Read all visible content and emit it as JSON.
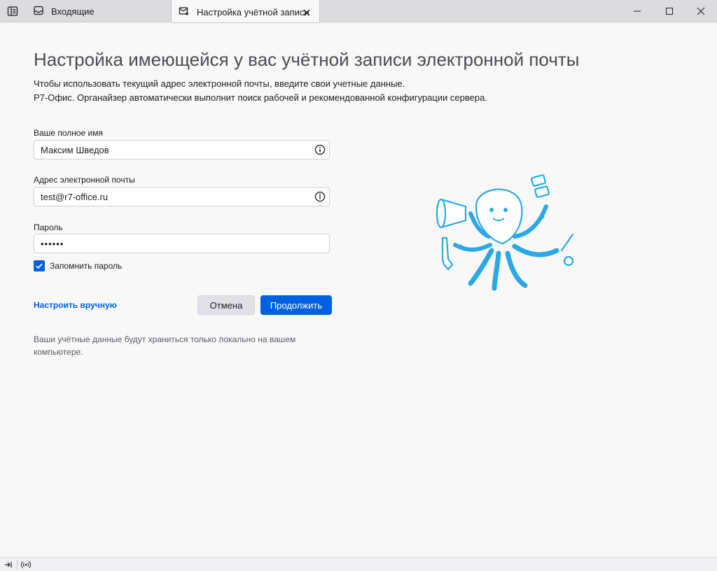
{
  "tabs": [
    {
      "label": "Входящие",
      "icon": "inbox-icon"
    },
    {
      "label": "Настройка учётной записи",
      "icon": "account-setup-icon"
    }
  ],
  "page": {
    "title": "Настройка имеющейся у вас учётной записи электронной почты",
    "description_line1": "Чтобы использовать текущий адрес электронной почты, введите свои учетные данные.",
    "description_line2": "Р7-Офис. Органайзер автоматически выполнит поиск рабочей и рекомендованной конфигурации сервера."
  },
  "form": {
    "name_label": "Ваше полное имя",
    "name_value": "Максим Шведов",
    "email_label": "Адрес электронной почты",
    "email_value": "test@r7-office.ru",
    "password_label": "Пароль",
    "password_value": "••••••",
    "remember_label": "Запомнить пароль",
    "remember_checked": true
  },
  "actions": {
    "manual_config": "Настроить вручную",
    "cancel": "Отмена",
    "continue": "Продолжить"
  },
  "footer_note": "Ваши учётные данные будут храниться только локально на вашем компьютере.",
  "colors": {
    "accent": "#0061e0",
    "mascot": "#2aa9e6"
  }
}
